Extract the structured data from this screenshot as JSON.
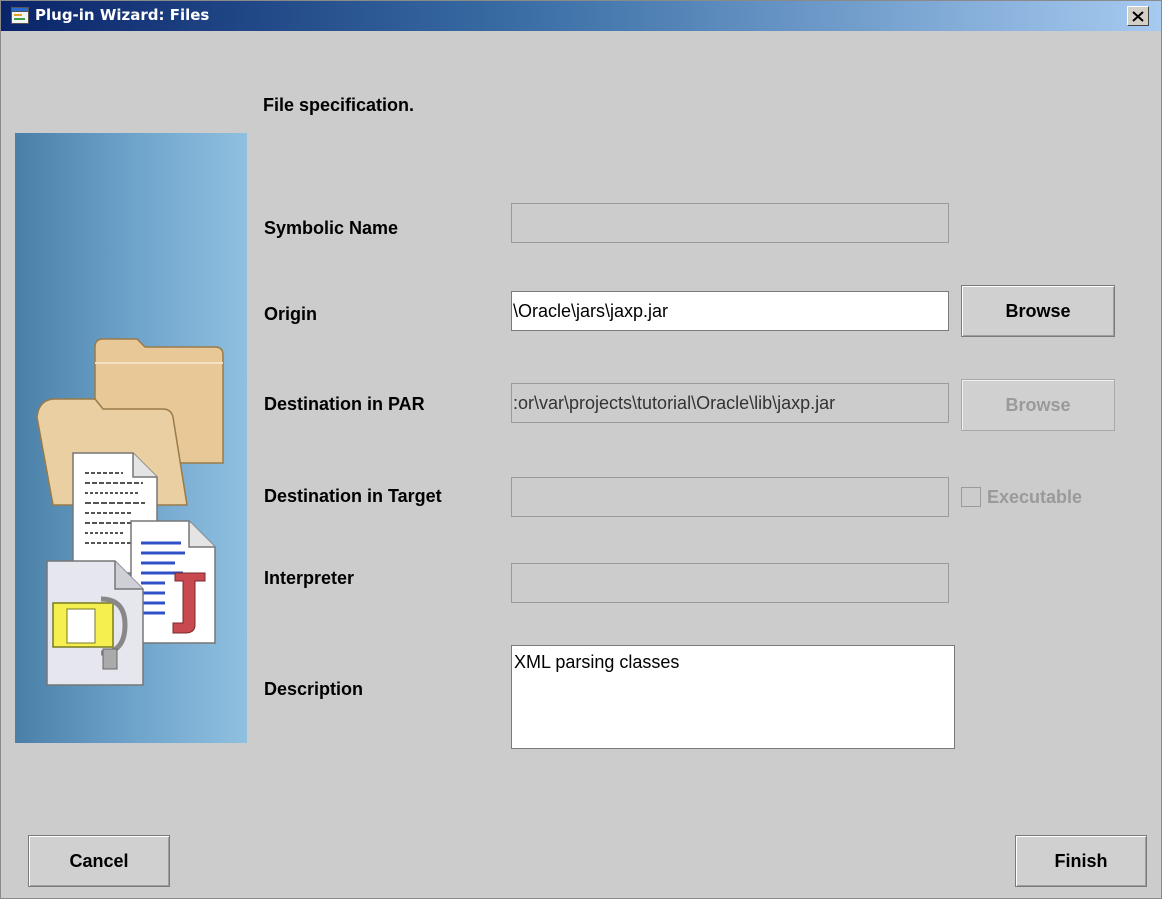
{
  "window": {
    "title": "Plug-in Wizard: Files"
  },
  "page": {
    "heading": "File specification."
  },
  "form": {
    "symbolic_name": {
      "label": "Symbolic Name",
      "value": ""
    },
    "origin": {
      "label": "Origin",
      "value": "\\Oracle\\jars\\jaxp.jar",
      "browse_label": "Browse"
    },
    "destination_par": {
      "label": "Destination in PAR",
      "value": ":or\\var\\projects\\tutorial\\Oracle\\lib\\jaxp.jar",
      "browse_label": "Browse"
    },
    "destination_target": {
      "label": "Destination in Target",
      "value": "",
      "checkbox_label": "Executable"
    },
    "interpreter": {
      "label": "Interpreter",
      "value": ""
    },
    "description": {
      "label": "Description",
      "value": "XML parsing classes"
    }
  },
  "footer": {
    "cancel_label": "Cancel",
    "finish_label": "Finish"
  },
  "colors": {
    "title_gradient_start": "#0a246a",
    "title_gradient_end": "#a6caf0",
    "dialog_background": "#cccccc",
    "art_panel": "#6aa0c8"
  }
}
